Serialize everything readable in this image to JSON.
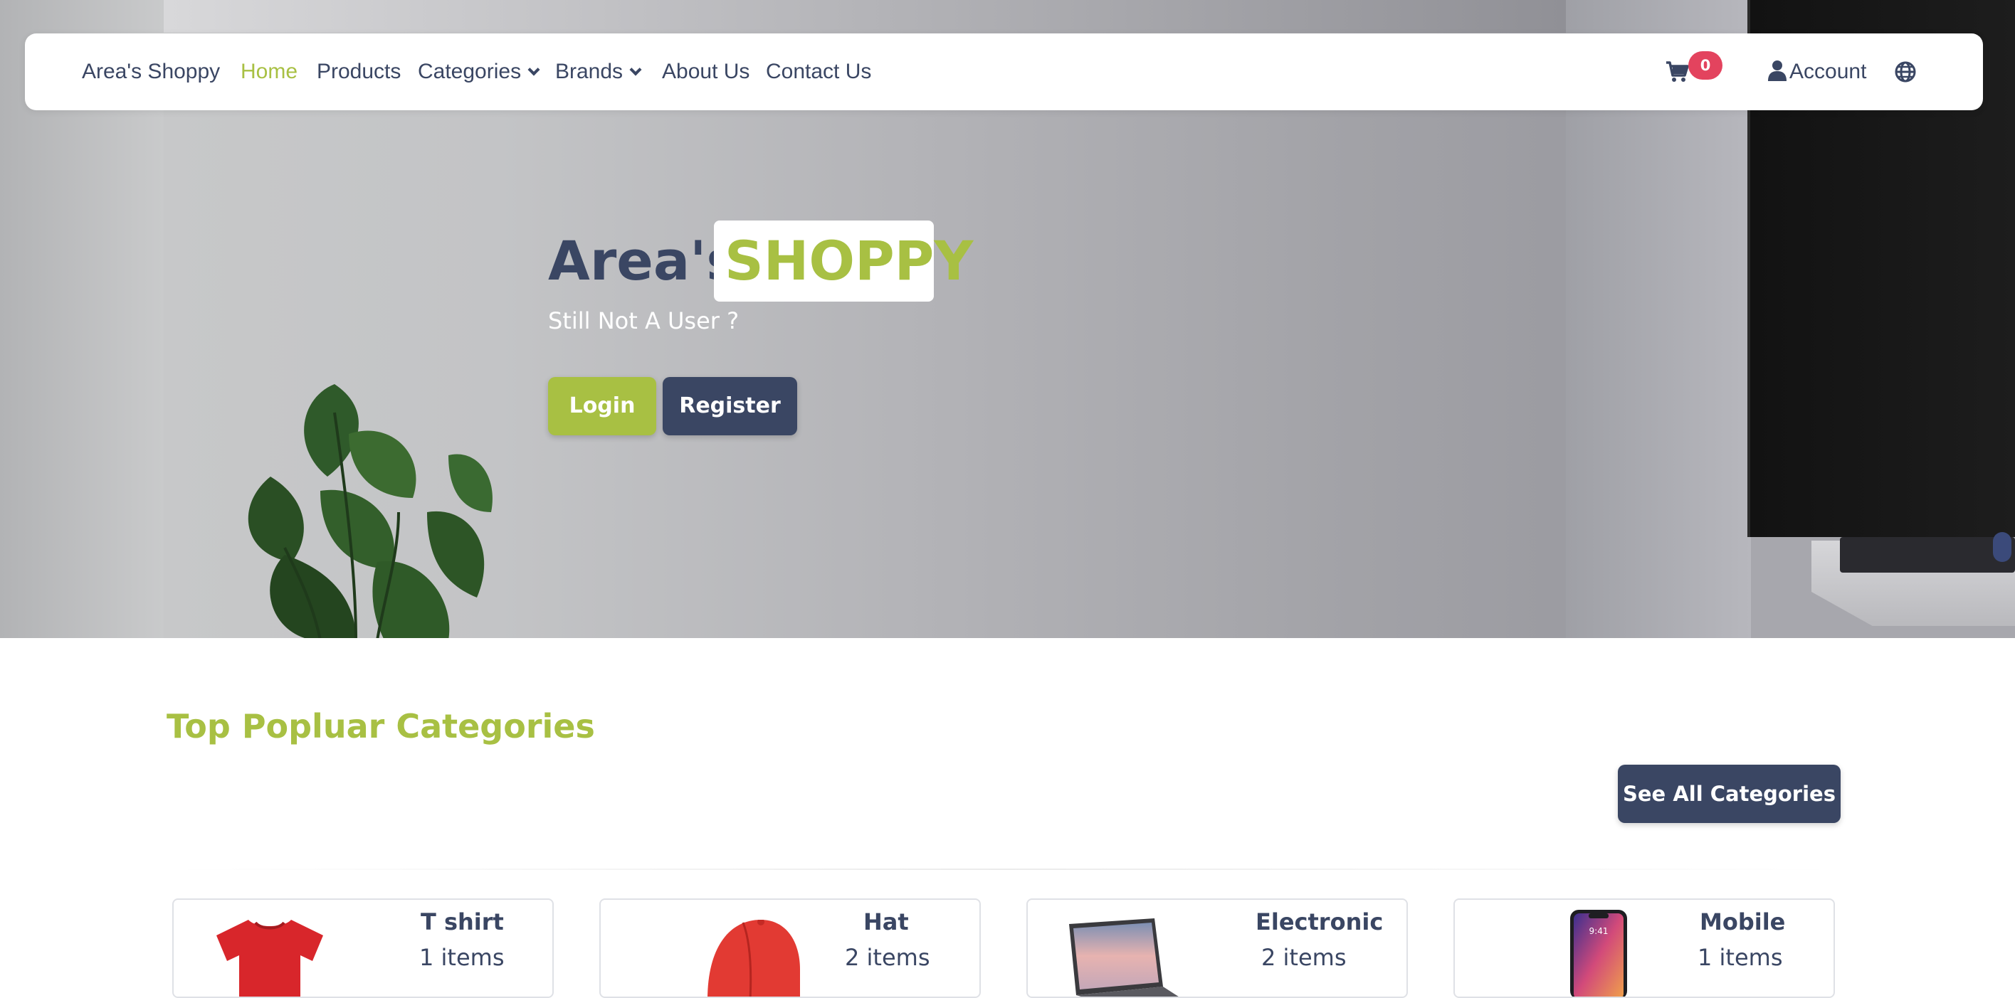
{
  "navbar": {
    "brand": "Area's Shoppy",
    "links": [
      {
        "label": "Home",
        "active": true
      },
      {
        "label": "Products"
      },
      {
        "label": "Categories",
        "dropdown": true
      },
      {
        "label": "Brands",
        "dropdown": true
      },
      {
        "label": "About Us"
      },
      {
        "label": "Contact Us"
      }
    ],
    "cart_count": "0",
    "account_label": "Account",
    "icons": {
      "cart": "cart-icon",
      "account": "user-icon",
      "language": "globe-icon"
    }
  },
  "hero": {
    "title_main": "Area's",
    "title_accent": "SHOPPY",
    "subtitle": "Still Not A User ?",
    "login_label": "Login",
    "register_label": "Register"
  },
  "categories": {
    "title": "Top Popluar Categories",
    "see_all_label": "See All Categories",
    "items": [
      {
        "name": "T shirt",
        "count": "1 items",
        "image": "tshirt-image"
      },
      {
        "name": "Hat",
        "count": "2 items",
        "image": "hat-image"
      },
      {
        "name": "Electronic",
        "count": "2 items",
        "image": "laptop-image"
      },
      {
        "name": "Mobile",
        "count": "1 items",
        "image": "phone-image"
      }
    ]
  },
  "colors": {
    "accent": "#a8c043",
    "primary": "#3a4663",
    "badge": "#e3435e"
  }
}
